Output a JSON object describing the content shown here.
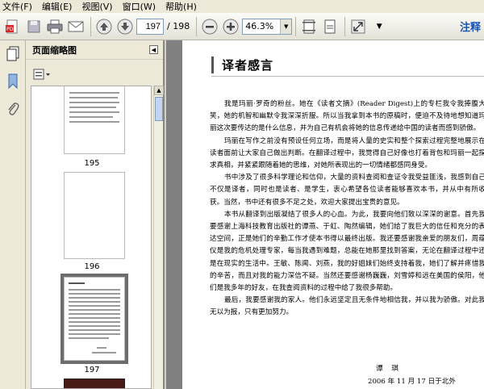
{
  "menu": {
    "file": "文件(F)",
    "edit": "编辑(E)",
    "view": "视图(V)",
    "window": "窗口(W)",
    "help": "帮助(H)"
  },
  "toolbar": {
    "page_current": "197",
    "page_total": "/ 198",
    "zoom_value": "46.3%",
    "right_text": "注释"
  },
  "panel": {
    "title": "页面缩略图",
    "thumbnails": [
      {
        "label": "195"
      },
      {
        "label": "196"
      },
      {
        "label": "197"
      },
      {
        "label": ""
      }
    ]
  },
  "document": {
    "heading": "译者感言",
    "paragraphs": [
      "我是玛丽·罗奇的粉丝。她在《读者文摘》(Reader Digest)上的专栏我令我捧腹大笑，她的机智和幽默令我深深折服。所以当我拿到本书的原稿时，便迫不及待地想知道玛丽这次要传达的是什么信息，并为自己有机会将她的信息传递给中国的读者而感到骄傲。",
      "玛丽在写作之前没有预设任何立场，而是将人量的史实和整个探索过程完整地展示在读者面前让大家自己做出判断。在翻译过程中，我觉得自己好像也打着背包和玛丽一起探求真相，并紧紧跟随着她的思维，对她所表现出的一切情绪都感同身受。",
      "书中涉及了很多科学理论和信仰，大量的资料查阅和查证令我受益匪浅，我感到自己不仅是译者，同时也是读者、是学生，衷心希望各位读者能够喜欢本书，并从中有所收获。当然，书中还有很多不足之处，欢迎大家提出宝贵的意见。",
      "本书从翻译到出版凝结了很多人的心血。为此，我要向他们致以深深的谢意。首先我要感谢上海科技教育出版社的谭燕、于虹、陶然编辑，她们给了我巨大的信任和充分的表达空间，正是她们的辛勤工作才使本书得以最终出版。我还要感谢我亲爱的朋友们，周蕴仪是我的危机处理专家，每当我遇到难题，总能在她那里找到答案，无论在翻译过程中还是在现实的生活中。王敏、陈闻、刘燕，我的好姐妹们始终支持着我，她们了解并疼惜我的辛苦，而且对我的能力深信不疑。当然还要感谢杨巍巍，刘雪婷和远在美国的侯阳，他们是我多年的好友，在我查阅资料的过程中给了我很多帮助。",
      "最后，我要感谢我的家人。他们永远坚定且无条件地相信我，并以我为骄傲。对此我无以为报，只有更加努力。"
    ],
    "signature": "谭 琪",
    "date": "2006 年 11 月 17 日于北外"
  }
}
